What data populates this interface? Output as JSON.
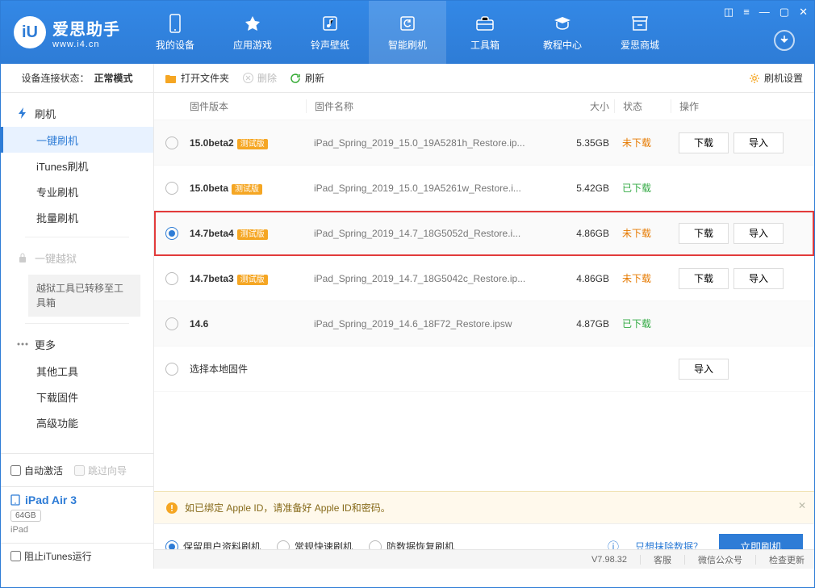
{
  "brand": {
    "title": "爱思助手",
    "sub": "www.i4.cn"
  },
  "nav": {
    "items": [
      {
        "label": "我的设备",
        "icon": "phone-icon"
      },
      {
        "label": "应用游戏",
        "icon": "apps-icon"
      },
      {
        "label": "铃声壁纸",
        "icon": "music-icon"
      },
      {
        "label": "智能刷机",
        "icon": "refresh-icon"
      },
      {
        "label": "工具箱",
        "icon": "toolbox-icon"
      },
      {
        "label": "教程中心",
        "icon": "tutorial-icon"
      },
      {
        "label": "爱思商城",
        "icon": "store-icon"
      }
    ],
    "active_index": 3
  },
  "sidebar": {
    "device_status_label": "设备连接状态：",
    "device_status_value": "正常模式",
    "flash_label": "刷机",
    "flash_items": [
      "一键刷机",
      "iTunes刷机",
      "专业刷机",
      "批量刷机"
    ],
    "flash_active_index": 0,
    "jailbreak_label": "一键越狱",
    "jailbreak_note": "越狱工具已转移至工具箱",
    "more_label": "更多",
    "more_items": [
      "其他工具",
      "下载固件",
      "高级功能"
    ],
    "auto_activate": "自动激活",
    "skip_guide": "跳过向导",
    "device_name": "iPad Air 3",
    "device_storage": "64GB",
    "device_type": "iPad",
    "block_itunes": "阻止iTunes运行"
  },
  "toolbar": {
    "open": "打开文件夹",
    "delete": "删除",
    "refresh": "刷新",
    "settings": "刷机设置"
  },
  "table": {
    "headers": {
      "version": "固件版本",
      "name": "固件名称",
      "size": "大小",
      "status": "状态",
      "ops": "操作"
    },
    "beta_tag": "测试版",
    "status_notdown": "未下载",
    "status_down": "已下载",
    "btn_download": "下载",
    "btn_import": "导入",
    "local_label": "选择本地固件",
    "rows": [
      {
        "version": "15.0beta2",
        "beta": true,
        "name": "iPad_Spring_2019_15.0_19A5281h_Restore.ip...",
        "size": "5.35GB",
        "status": "notdown",
        "ops": [
          "download",
          "import"
        ],
        "selected": false
      },
      {
        "version": "15.0beta",
        "beta": true,
        "name": "iPad_Spring_2019_15.0_19A5261w_Restore.i...",
        "size": "5.42GB",
        "status": "down",
        "ops": [],
        "selected": false
      },
      {
        "version": "14.7beta4",
        "beta": true,
        "name": "iPad_Spring_2019_14.7_18G5052d_Restore.i...",
        "size": "4.86GB",
        "status": "notdown",
        "ops": [
          "download",
          "import"
        ],
        "selected": true,
        "highlight": true
      },
      {
        "version": "14.7beta3",
        "beta": true,
        "name": "iPad_Spring_2019_14.7_18G5042c_Restore.ip...",
        "size": "4.86GB",
        "status": "notdown",
        "ops": [
          "download",
          "import"
        ],
        "selected": false
      },
      {
        "version": "14.6",
        "beta": false,
        "name": "iPad_Spring_2019_14.6_18F72_Restore.ipsw",
        "size": "4.87GB",
        "status": "down",
        "ops": [],
        "selected": false
      }
    ]
  },
  "notice": "如已绑定 Apple ID，请准备好 Apple ID和密码。",
  "flash_options": {
    "items": [
      "保留用户资料刷机",
      "常规快速刷机",
      "防数据恢复刷机"
    ],
    "selected_index": 0,
    "wipe_link": "只想抹除数据？",
    "flash_now": "立即刷机"
  },
  "statusbar": {
    "version": "V7.98.32",
    "service": "客服",
    "wechat": "微信公众号",
    "update": "检查更新"
  }
}
